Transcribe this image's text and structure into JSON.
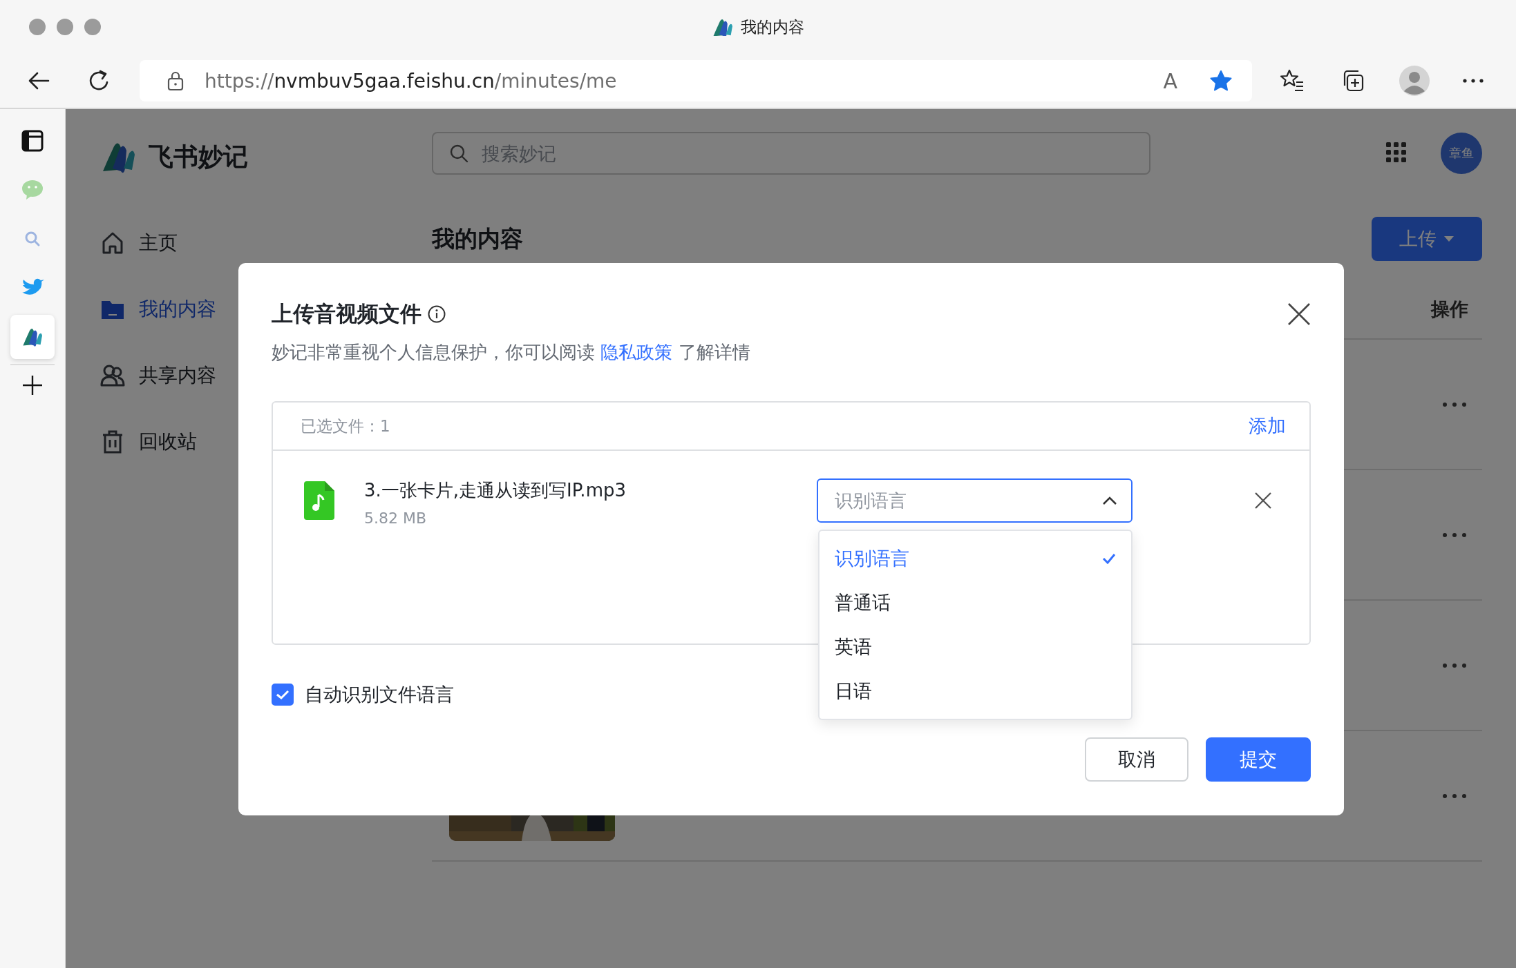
{
  "browser": {
    "tab_title": "我的内容",
    "url": {
      "scheme": "https://",
      "host": "nvmbuv5gaa.feishu.cn",
      "path": "/minutes/me"
    },
    "read_aloud": "A",
    "favorited": true
  },
  "side_panel": {
    "items": [
      {
        "kind": "sidebar",
        "selected": false
      },
      {
        "kind": "chat",
        "selected": false
      },
      {
        "kind": "search",
        "selected": false
      },
      {
        "kind": "bird",
        "selected": false
      },
      {
        "kind": "minutes",
        "selected": true
      }
    ]
  },
  "app": {
    "brand": "飞书妙记",
    "nav": [
      {
        "kind": "home",
        "label": "主页",
        "selected": false
      },
      {
        "kind": "folder",
        "label": "我的内容",
        "selected": true
      },
      {
        "kind": "people",
        "label": "共享内容",
        "selected": false
      },
      {
        "kind": "trash",
        "label": "回收站",
        "selected": false
      }
    ],
    "search": {
      "placeholder": "搜索妙记"
    },
    "avatar": "章鱼",
    "page_title": "我的内容",
    "upload_button": "上传",
    "columns": [
      "操作"
    ],
    "rows": [
      {
        "kind": "plain"
      },
      {
        "kind": "plain"
      },
      {
        "kind": "plain"
      },
      {
        "kind": "picture"
      }
    ]
  },
  "dialog": {
    "title": "上传音视频文件",
    "notice": {
      "before": "妙记非常重视个人信息保护，你可以阅读 ",
      "link": "隐私政策",
      "after": " 了解详情"
    },
    "selected_count": "已选文件：1",
    "add": "添加",
    "files": [
      {
        "name": "3.一张卡片,走通从读到写IP.mp3",
        "size": "5.82 MB",
        "language": {
          "placeholder": "识别语言",
          "expanded": true,
          "options": [
            {
              "label": "识别语言",
              "selected": true
            },
            {
              "label": "普通话",
              "selected": false
            },
            {
              "label": "英语",
              "selected": false
            },
            {
              "label": "日语",
              "selected": false
            }
          ]
        }
      }
    ],
    "auto_detect": {
      "label": "自动识别文件语言",
      "checked": true
    },
    "buttons": [
      {
        "label": "取消",
        "kind": "secondary"
      },
      {
        "label": "提交",
        "kind": "primary"
      }
    ]
  }
}
